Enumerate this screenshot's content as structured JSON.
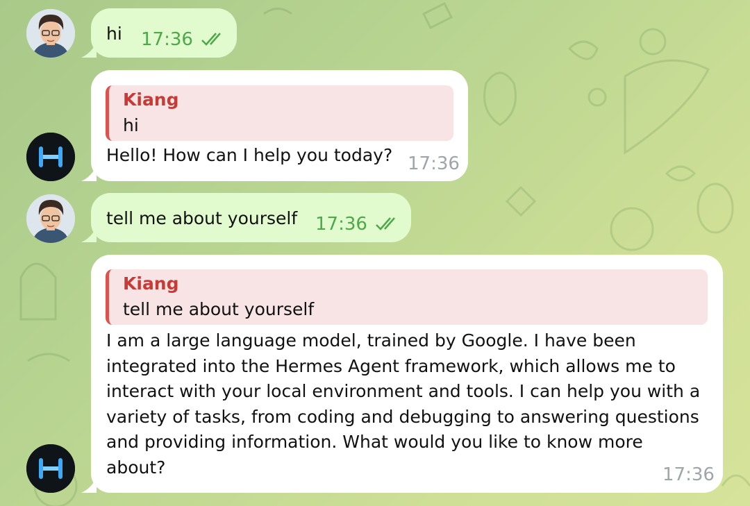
{
  "chat": {
    "messages": [
      {
        "id": "m1",
        "sender": "user",
        "text": "hi",
        "time": "17:36",
        "status_icon": "double-check-icon"
      },
      {
        "id": "m2",
        "sender": "bot",
        "reply_to": {
          "name": "Kiang",
          "text": "hi"
        },
        "text": "Hello! How can I help you today?",
        "time": "17:36"
      },
      {
        "id": "m3",
        "sender": "user",
        "text": "tell me about yourself",
        "time": "17:36",
        "status_icon": "double-check-icon"
      },
      {
        "id": "m4",
        "sender": "bot",
        "reply_to": {
          "name": "Kiang",
          "text": "tell me about yourself"
        },
        "lines": [
          "I am a large language model, trained by Google. I have been",
          "integrated into the Hermes Agent framework, which allows me to",
          "interact with your local environment and tools. I can help you with a",
          "variety of tasks, from coding and debugging to answering questions",
          "and providing information. What would you like to know more",
          "about?"
        ],
        "time": "17:36"
      }
    ]
  },
  "colors": {
    "outgoing_bubble": "#e1fbce",
    "incoming_bubble": "#ffffff",
    "reply_accent": "#d9534f",
    "time_outgoing": "#4ea84a"
  }
}
